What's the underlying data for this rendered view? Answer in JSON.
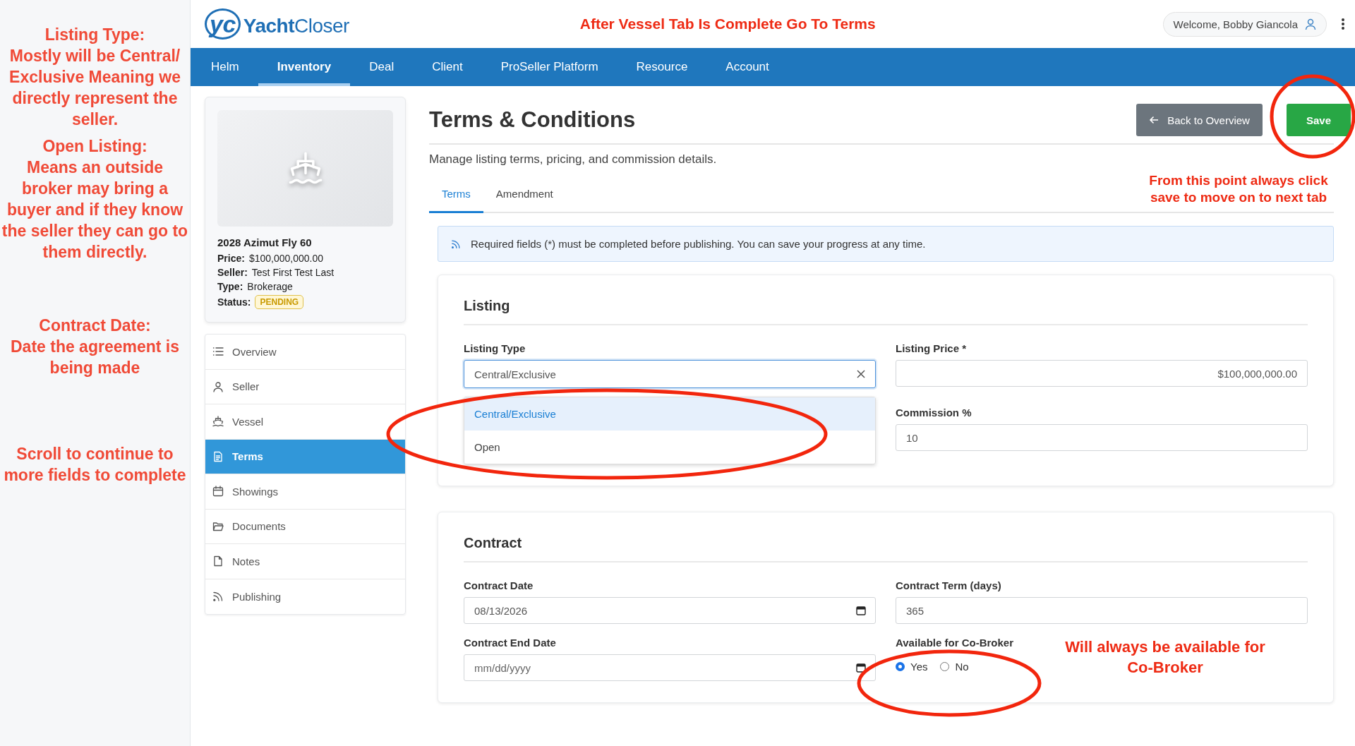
{
  "notes": [
    {
      "title": "Listing Type:",
      "text": "Mostly will be Central/ Exclusive Meaning we directly represent the seller."
    },
    {
      "title": "Open Listing:",
      "text": "Means an outside broker may bring a buyer and if they know the seller they can go to them directly."
    },
    {
      "title": "Contract Date:",
      "text": "Date the agreement is being made"
    },
    {
      "text": "Scroll to continue to more fields to complete"
    }
  ],
  "header": {
    "logo_mark": "yc",
    "logo_bold": "Yacht",
    "logo_light": "Closer",
    "annotation": "After Vessel Tab Is Complete Go To Terms",
    "welcome": "Welcome, Bobby Giancola"
  },
  "nav": [
    {
      "label": "Helm",
      "selected": false
    },
    {
      "label": "Inventory",
      "selected": true
    },
    {
      "label": "Deal",
      "selected": false
    },
    {
      "label": "Client",
      "selected": false
    },
    {
      "label": "ProSeller Platform",
      "selected": false
    },
    {
      "label": "Resource",
      "selected": false
    },
    {
      "label": "Account",
      "selected": false
    }
  ],
  "listing_card": {
    "title": "2028 Azimut Fly 60",
    "fields": [
      {
        "label": "Price:",
        "value": "$100,000,000.00",
        "kind": "text"
      },
      {
        "label": "Seller:",
        "value": "Test First Test Last",
        "kind": "text"
      },
      {
        "label": "Type:",
        "value": "Brokerage",
        "kind": "text"
      },
      {
        "label": "Status:",
        "value": "PENDING",
        "kind": "badge"
      }
    ]
  },
  "sidebar": [
    {
      "label": "Overview",
      "selected": false
    },
    {
      "label": "Seller",
      "selected": false
    },
    {
      "label": "Vessel",
      "selected": false
    },
    {
      "label": "Terms",
      "selected": true
    },
    {
      "label": "Showings",
      "selected": false
    },
    {
      "label": "Documents",
      "selected": false
    },
    {
      "label": "Notes",
      "selected": false
    },
    {
      "label": "Publishing",
      "selected": false
    }
  ],
  "page": {
    "title": "Terms & Conditions",
    "subtitle": "Manage listing terms, pricing, and commission details.",
    "back_button": "Back to Overview",
    "save_button": "Save",
    "annotation": "From this point always click save to move on to next tab"
  },
  "tabs": [
    {
      "label": "Terms",
      "selected": true
    },
    {
      "label": "Amendment",
      "selected": false
    }
  ],
  "notice": "Required fields (*) must be completed before publishing. You can save your progress at any time.",
  "listing": {
    "title": "Listing",
    "listing_type": {
      "label": "Listing Type",
      "value": "Central/Exclusive",
      "options": [
        {
          "label": "Central/Exclusive",
          "selected": true
        },
        {
          "label": "Open",
          "selected": false
        }
      ]
    },
    "listing_price": {
      "label": "Listing Price *",
      "value": "$100,000,000.00"
    },
    "commission": {
      "label": "Commission %",
      "value": "10"
    }
  },
  "contract": {
    "title": "Contract",
    "contract_date": {
      "label": "Contract Date",
      "value": "08/13/2026"
    },
    "term": {
      "label": "Contract Term (days)",
      "value": "365"
    },
    "end_date": {
      "label": "Contract End Date",
      "placeholder": "mm/dd/yyyy"
    },
    "co_broker": {
      "label": "Available for Co-Broker",
      "options": [
        {
          "label": "Yes",
          "selected": true
        },
        {
          "label": "No",
          "selected": false
        }
      ],
      "annotation": "Will always be available for Co-Broker"
    }
  }
}
